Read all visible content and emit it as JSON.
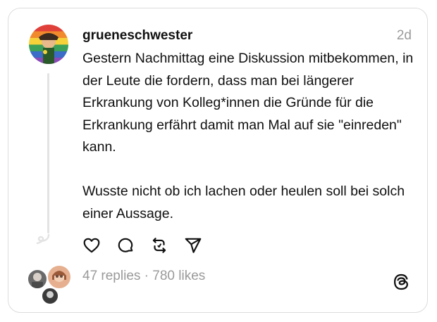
{
  "post": {
    "username": "grueneschwester",
    "timestamp": "2d",
    "paragraphs": [
      "Gestern Nachmittag eine Diskussion mitbekommen, in der Leute die fordern, dass man bei längerer Erkrankung von Kolleg*innen die Gründe für die Erkrankung erfährt damit man Mal auf sie \"einreden\" kann.",
      "Wusste nicht ob ich lachen oder heulen soll bei solch einer Aussage."
    ],
    "actions": [
      "heart-icon",
      "comment-icon",
      "repost-icon",
      "share-icon"
    ],
    "replies_label": "47 replies",
    "separator": "·",
    "likes_label": "780 likes"
  }
}
